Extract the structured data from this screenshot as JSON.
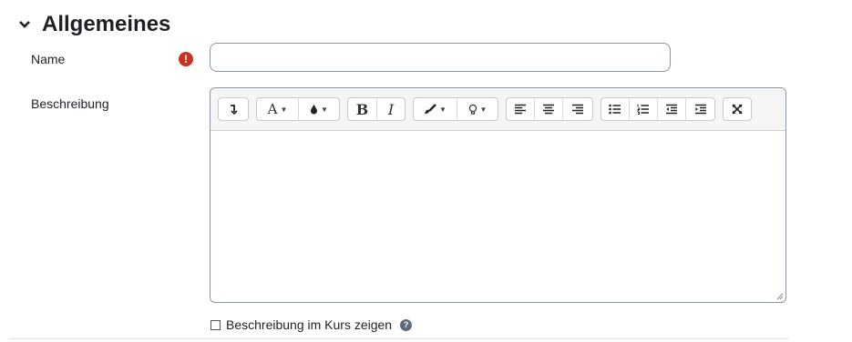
{
  "section": {
    "title": "Allgemeines",
    "chevron_icon": "chevron-down-icon"
  },
  "form": {
    "name_label": "Name",
    "name_value": "",
    "required_icon": "exclamation-circle-icon",
    "description_label": "Beschreibung",
    "show_description_label": "Beschreibung im Kurs zeigen",
    "show_description_checked": false,
    "help_icon": "question-circle-icon"
  },
  "editor": {
    "content": "",
    "toolbar_groups": [
      [
        "collapse-toggle-icon"
      ],
      [
        "font-color-icon",
        "background-color-icon"
      ],
      [
        "bold-icon",
        "italic-icon"
      ],
      [
        "paint-brush-icon",
        "lightbulb-icon"
      ],
      [
        "align-left-icon",
        "align-center-icon",
        "align-right-icon"
      ],
      [
        "unordered-list-icon",
        "ordered-list-icon",
        "outdent-icon",
        "indent-icon"
      ],
      [
        "fullscreen-icon"
      ]
    ]
  },
  "colors": {
    "required": "#ca3120",
    "border": "#8f959e",
    "toolbar_bg": "#f5f5f5",
    "help": "#5e6b78"
  }
}
